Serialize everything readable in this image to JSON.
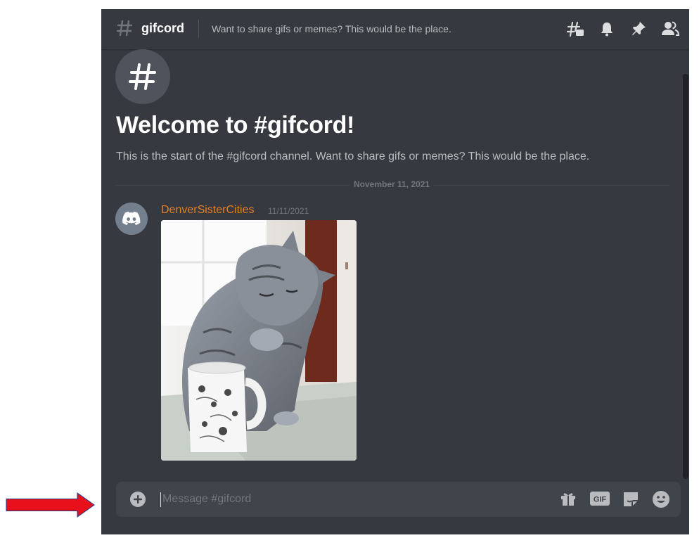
{
  "channel": {
    "name": "gifcord",
    "topic": "Want to share gifs or memes? This would be the place."
  },
  "header_icons": [
    "threads-icon",
    "bell-icon",
    "pin-icon",
    "members-icon"
  ],
  "welcome": {
    "title": "Welcome to #gifcord!",
    "description": "This is the start of the #gifcord channel. Want to share gifs or memes? This would be the place."
  },
  "divider": {
    "date": "November 11, 2021"
  },
  "message": {
    "author": "DenverSisterCities",
    "timestamp": "11/11/2021",
    "attachment": "cat-gif"
  },
  "composer": {
    "placeholder": "Message #gifcord",
    "gif_label": "GIF",
    "icons": [
      "add-icon",
      "gift-icon",
      "gif-icon",
      "sticker-icon",
      "emoji-icon"
    ]
  },
  "colors": {
    "background": "#36393f",
    "author": "#e67e22",
    "input_bg": "#40444b",
    "annotation_arrow": "#e8101a"
  }
}
